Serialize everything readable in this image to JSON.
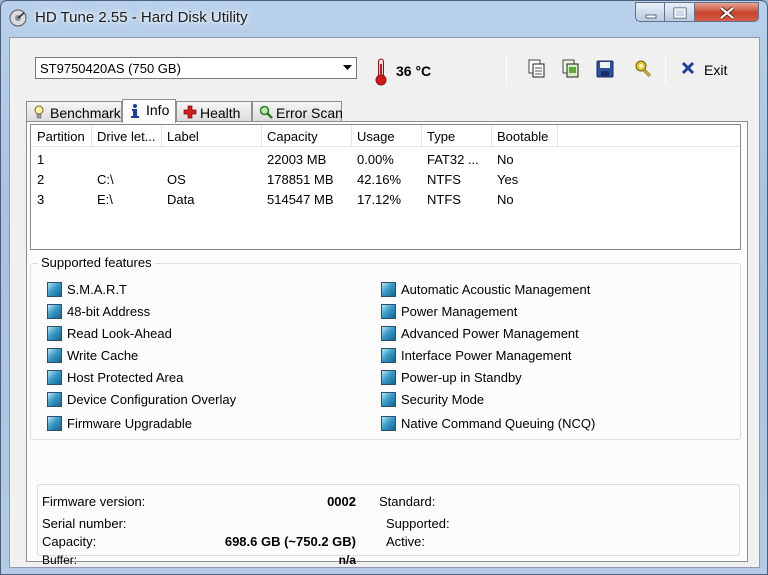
{
  "window": {
    "title": "HD Tune 2.55 - Hard Disk Utility"
  },
  "toolbar": {
    "drive": "ST9750420AS (750 GB)",
    "temperature": "36 °C",
    "exit_label": "Exit",
    "buttons": [
      "copy-text-icon",
      "copy-screenshot-icon",
      "save-icon",
      "options-icon"
    ]
  },
  "tabs": [
    {
      "label": "Benchmark",
      "icon": "lightbulb-icon"
    },
    {
      "label": "Info",
      "icon": "info-icon",
      "active": true
    },
    {
      "label": "Health",
      "icon": "health-cross-icon"
    },
    {
      "label": "Error Scan",
      "icon": "magnifier-icon"
    }
  ],
  "partitions": {
    "columns": [
      "Partition",
      "Drive let...",
      "Label",
      "Capacity",
      "Usage",
      "Type",
      "Bootable"
    ],
    "rows": [
      [
        "1",
        "",
        "",
        "22003 MB",
        "0.00%",
        "FAT32 ...",
        "No"
      ],
      [
        "2",
        "C:\\",
        "OS",
        "178851 MB",
        "42.16%",
        "NTFS",
        "Yes"
      ],
      [
        "3",
        "E:\\",
        "Data",
        "514547 MB",
        "17.12%",
        "NTFS",
        "No"
      ]
    ]
  },
  "features": {
    "legend": "Supported features",
    "left": [
      "S.M.A.R.T",
      "48-bit Address",
      "Read Look-Ahead",
      "Write Cache",
      "Host Protected Area",
      "Device Configuration Overlay",
      "Firmware Upgradable"
    ],
    "right": [
      "Automatic Acoustic Management",
      "Power Management",
      "Advanced Power Management",
      "Interface Power Management",
      "Power-up in Standby",
      "Security Mode",
      "Native Command Queuing (NCQ)"
    ]
  },
  "details": {
    "firmware_label": "Firmware version:",
    "firmware_value": "0002",
    "serial_label": "Serial number:",
    "serial_value": "",
    "capacity_label": "Capacity:",
    "capacity_value": "698.6 GB (~750.2 GB)",
    "buffer_label": "Buffer:",
    "buffer_value": "n/a",
    "standard_label": "Standard:",
    "supported_label": "Supported:",
    "active_label": "Active:"
  },
  "colors": {
    "titlebar": "#b9d1ea",
    "close_button": "#c7432a",
    "feature_checkbox": "#3a9cc9"
  }
}
